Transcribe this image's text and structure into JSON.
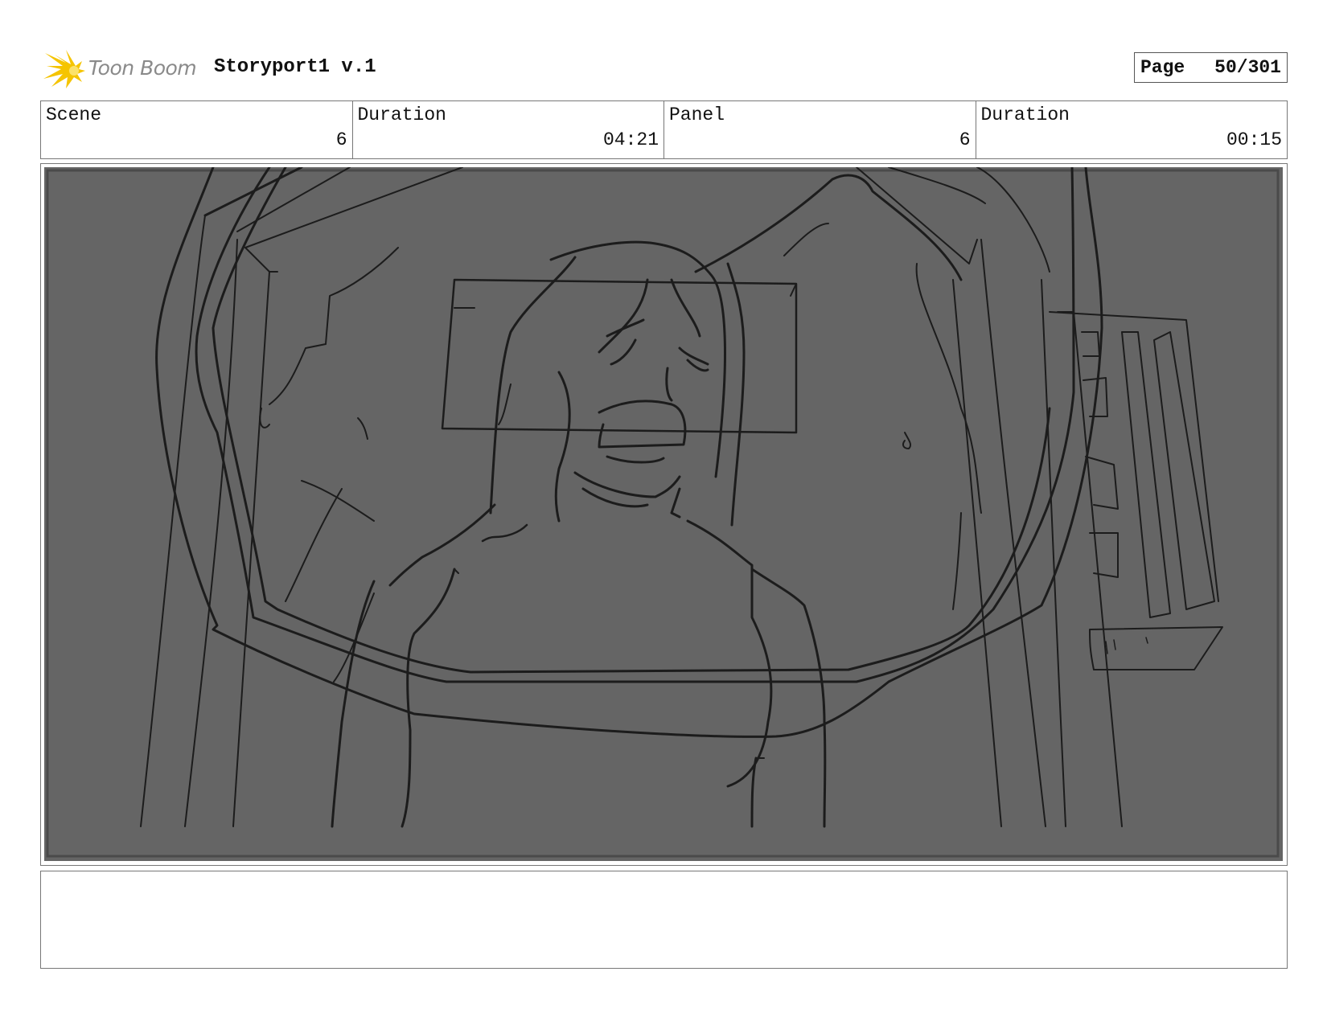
{
  "header": {
    "logo_text": "Toon Boom",
    "project_title": "Storyport1 v.1",
    "page_label": "Page",
    "page_value": "50/301"
  },
  "info": {
    "scene_label": "Scene",
    "scene_value": "6",
    "scene_duration_label": "Duration",
    "scene_duration_value": "04:21",
    "panel_label": "Panel",
    "panel_value": "6",
    "panel_duration_label": "Duration",
    "panel_duration_value": "00:15"
  },
  "notes": {
    "text": ""
  },
  "colors": {
    "panel_background": "#656565",
    "sketch_line": "#1c1c1c",
    "logo_accent": "#f5c400",
    "logo_text": "#8a8a8a"
  }
}
